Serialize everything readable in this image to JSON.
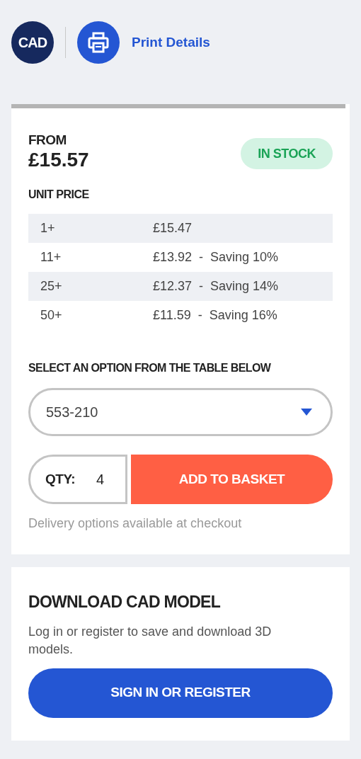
{
  "header": {
    "cad_badge": "CAD",
    "print_link": "Print Details"
  },
  "price_card": {
    "from_label": "FROM",
    "from_price": "£15.57",
    "stock_badge": "IN STOCK",
    "unit_price_label": "UNIT PRICE",
    "price_rows": [
      {
        "quantity": "1+",
        "price": "£15.47"
      },
      {
        "quantity": "11+",
        "price": "£13.92  -  Saving 10%"
      },
      {
        "quantity": "25+",
        "price": "£12.37  -  Saving 14%"
      },
      {
        "quantity": "50+",
        "price": "£11.59  -  Saving 16%"
      }
    ],
    "select_label": "SELECT AN OPTION FROM THE TABLE BELOW",
    "option_value": "553-210",
    "qty_label": "QTY:",
    "qty_value": "4",
    "add_button": "ADD TO BASKET",
    "delivery_note": "Delivery options available at checkout"
  },
  "cad_card": {
    "title": "DOWNLOAD CAD MODEL",
    "text": "Log in or register to save and download 3D models.",
    "button": "SIGN IN OR REGISTER"
  }
}
